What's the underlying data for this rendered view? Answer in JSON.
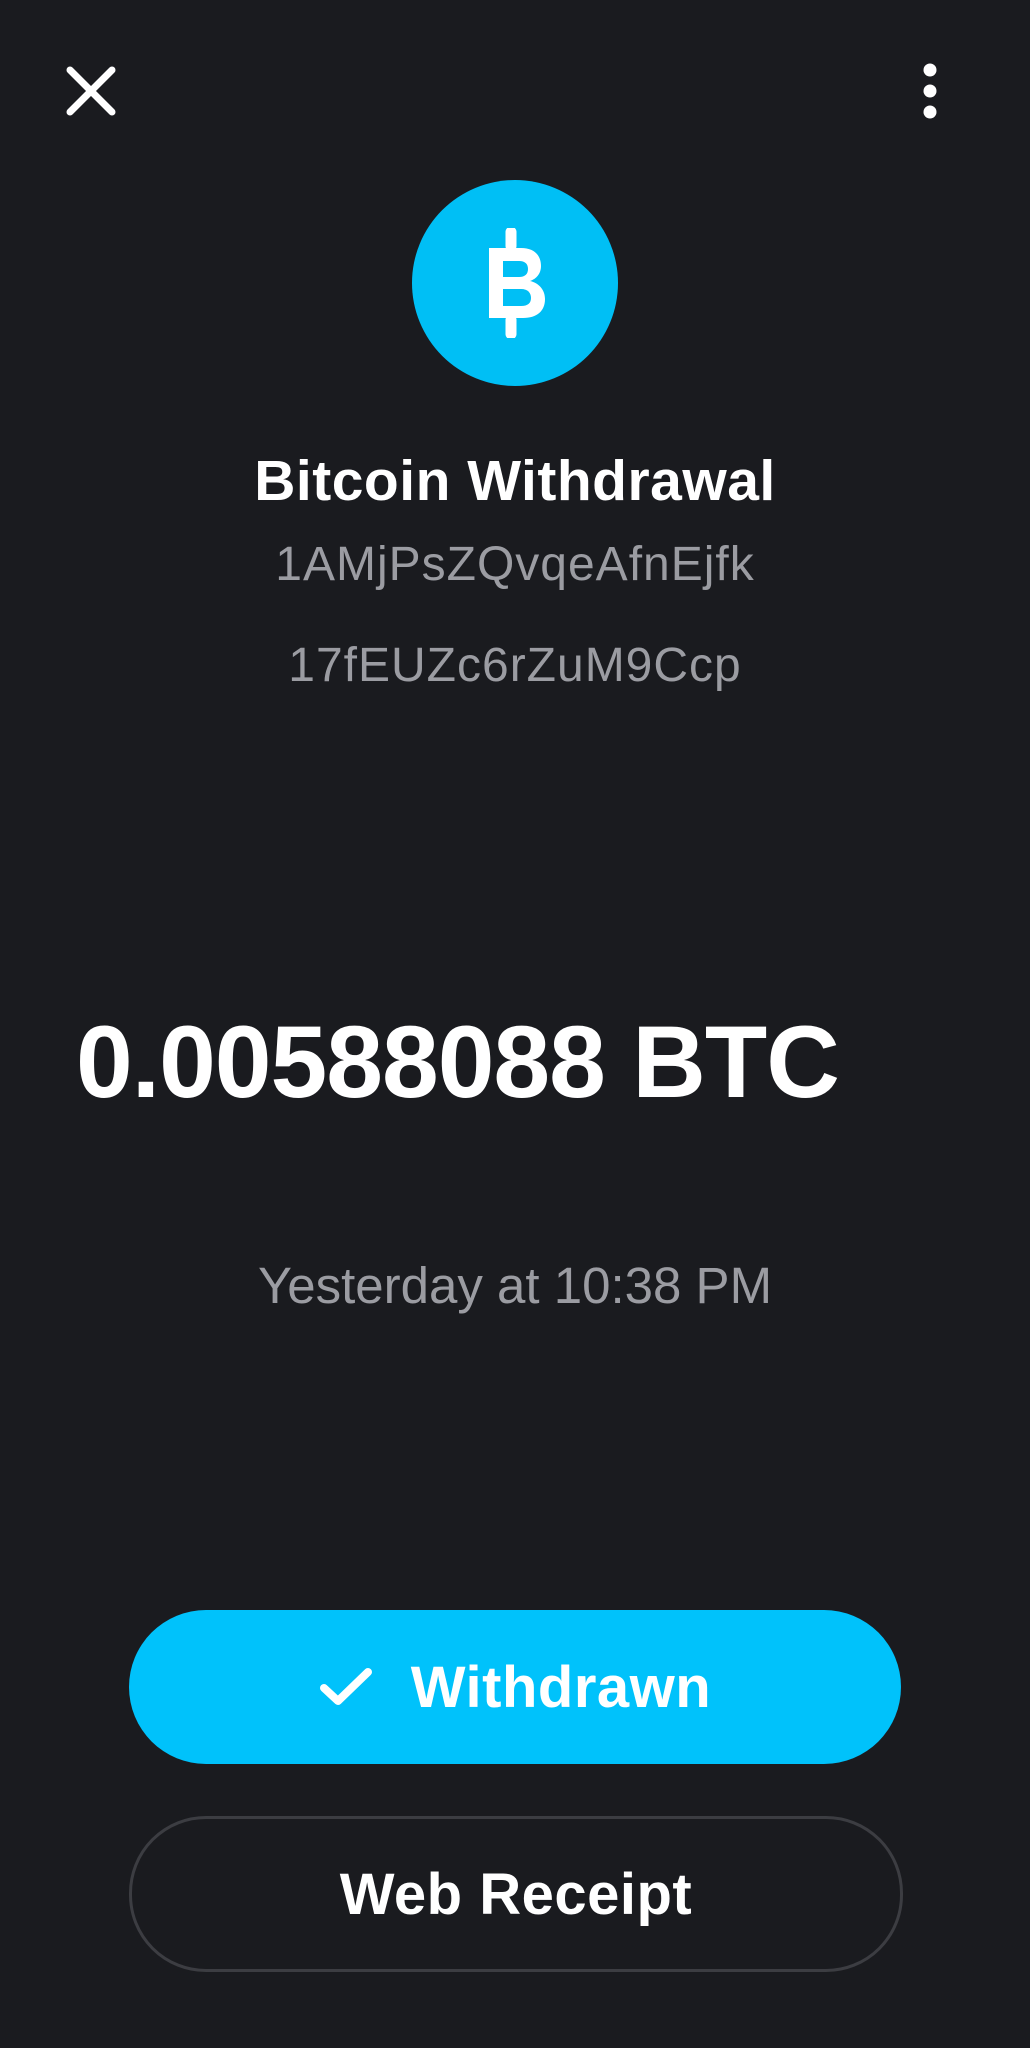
{
  "header": {
    "close_icon": "close-icon",
    "more_icon": "more-vertical-icon"
  },
  "transaction": {
    "icon": "bitcoin-icon",
    "title": "Bitcoin Withdrawal",
    "address_line_1": "1AMjPsZQvqeAfnEjfk",
    "address_line_2": "17fEUZc6rZuM9Ccp",
    "amount": "0.00588088 BTC",
    "timestamp": "Yesterday at 10:38 PM"
  },
  "actions": {
    "status_button_icon": "checkmark-icon",
    "status_button_label": "Withdrawn",
    "receipt_button_label": "Web Receipt"
  },
  "colors": {
    "background": "#1a1b1f",
    "accent": "#00c2fb",
    "secondary_text": "#9b9ca2"
  }
}
